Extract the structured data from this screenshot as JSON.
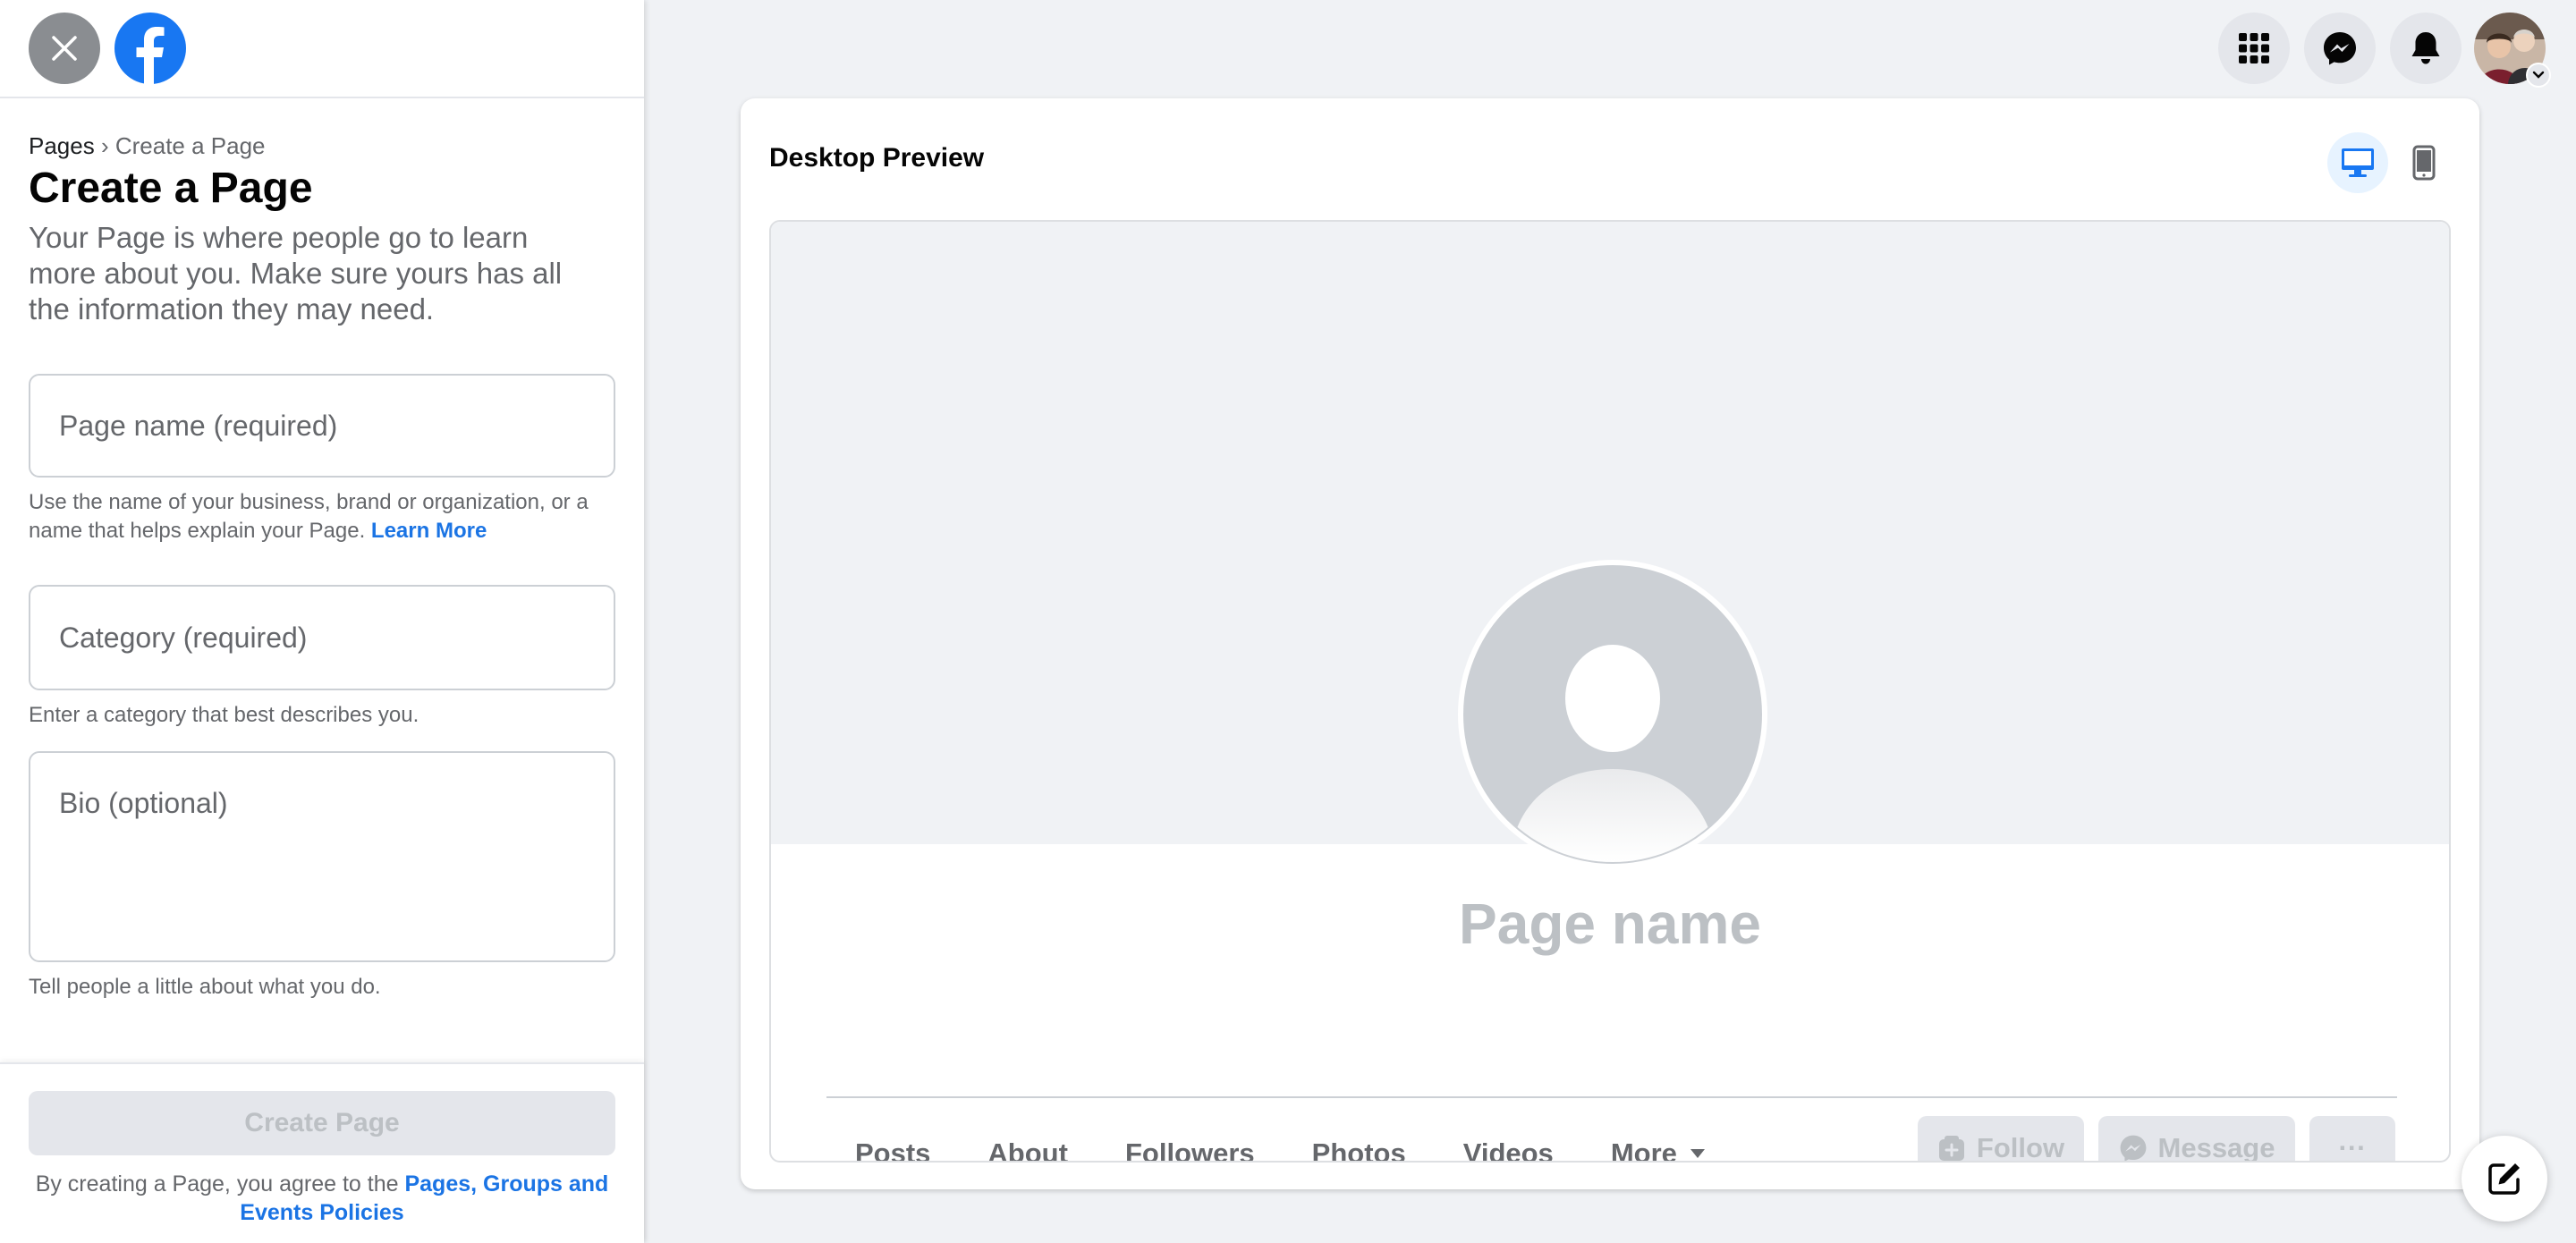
{
  "left": {
    "breadcrumb": {
      "root": "Pages",
      "separator": " › ",
      "current": "Create a Page"
    },
    "title": "Create a Page",
    "description": "Your Page is where people go to learn more about you. Make sure yours has all the information they may need.",
    "fields": {
      "page_name": {
        "placeholder": "Page name (required)",
        "value": "",
        "helper": "Use the name of your business, brand or organization, or a name that helps explain your Page.",
        "helper_link": "Learn More"
      },
      "category": {
        "placeholder": "Category (required)",
        "value": "",
        "helper": "Enter a category that best describes you."
      },
      "bio": {
        "placeholder": "Bio (optional)",
        "value": "",
        "helper": "Tell people a little about what you do."
      }
    },
    "footer": {
      "create_button": "Create Page",
      "agree_text": "By creating a Page, you agree to the ",
      "agree_link": "Pages, Groups and Events Policies"
    }
  },
  "topbar": {
    "icons": [
      "menu-grid-icon",
      "messenger-icon",
      "notifications-bell-icon",
      "account-avatar"
    ]
  },
  "preview": {
    "title": "Desktop Preview",
    "selected_device": "desktop",
    "page_name_placeholder": "Page name",
    "tabs": [
      "Posts",
      "About",
      "Followers",
      "Photos",
      "Videos",
      "More"
    ],
    "actions": {
      "follow": "Follow",
      "message": "Message",
      "more": "···"
    }
  },
  "colors": {
    "brand_blue": "#1877f2",
    "link_blue": "#1b74e4",
    "background": "#f0f2f5",
    "disabled_button": "#e4e6eb",
    "disabled_text": "#bcc0c4",
    "secondary_text": "#65676b"
  }
}
